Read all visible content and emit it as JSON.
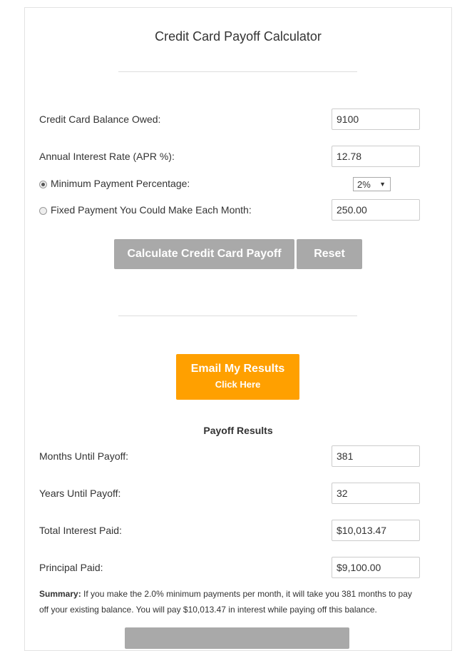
{
  "title": "Credit Card Payoff Calculator",
  "form": {
    "balance_label": "Credit Card Balance Owed:",
    "balance_value": "9100",
    "apr_label": "Annual Interest Rate (APR %):",
    "apr_value": "12.78",
    "min_label": "Minimum Payment Percentage:",
    "min_value": "2%",
    "min_selected": true,
    "fixed_label": "Fixed Payment You Could Make Each Month:",
    "fixed_value": "250.00",
    "fixed_selected": false,
    "calculate": "Calculate Credit Card Payoff",
    "reset": "Reset"
  },
  "email": {
    "line1": "Email My Results",
    "line2": "Click Here",
    "color": "#ffa000"
  },
  "results": {
    "heading": "Payoff Results",
    "rows": [
      {
        "label": "Months Until Payoff:",
        "value": "381"
      },
      {
        "label": "Years Until Payoff:",
        "value": "32"
      },
      {
        "label": "Total Interest Paid:",
        "value": "$10,013.47"
      },
      {
        "label": "Principal Paid:",
        "value": "$9,100.00"
      }
    ],
    "summary_label": "Summary:",
    "summary_text": " If you make the 2.0% minimum payments per month, it will take you 381 months to pay off your existing balance. You will pay $10,013.47 in interest while paying off this balance."
  }
}
